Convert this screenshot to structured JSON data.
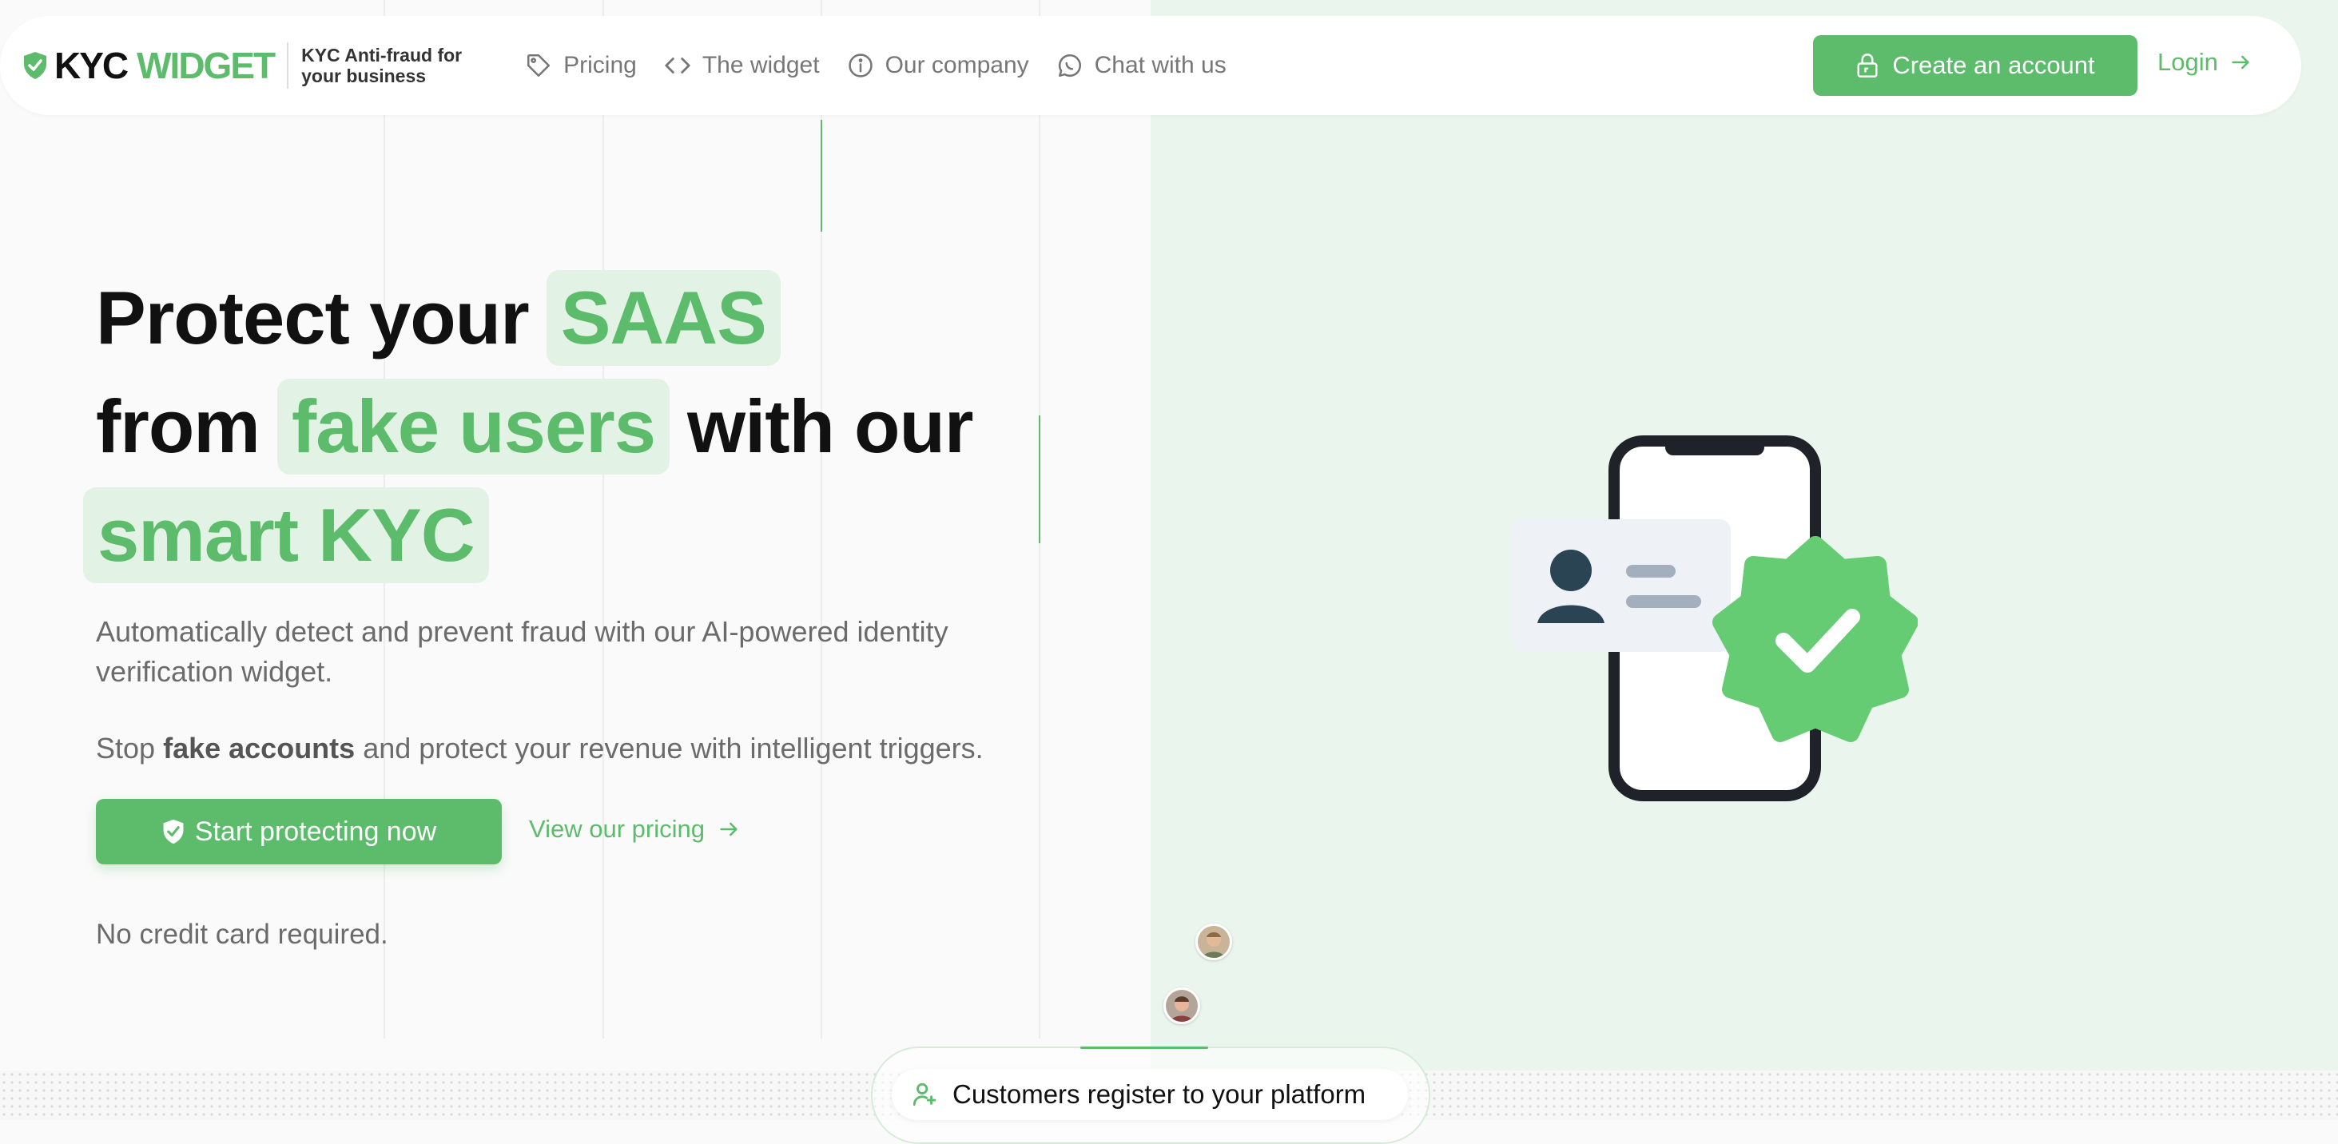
{
  "brand": {
    "kyc": "KYC",
    "widget": "WIDGET",
    "tagline_line1": "KYC Anti-fraud for",
    "tagline_line2": "your business"
  },
  "nav": {
    "items": [
      {
        "label": "Pricing",
        "icon": "tag-icon"
      },
      {
        "label": "The widget",
        "icon": "code-icon"
      },
      {
        "label": "Our company",
        "icon": "info-icon"
      },
      {
        "label": "Chat with us",
        "icon": "chat-icon"
      }
    ],
    "create_account": "Create an account",
    "login": "Login"
  },
  "hero": {
    "line1_text": "Protect your",
    "line1_chip": "SAAS",
    "line2_text": "from",
    "line2_chip": "fake users",
    "line2_tail": "with our",
    "line3_chip": "smart KYC",
    "subtitle": "Automatically detect and prevent fraud with our AI-powered identity verification widget.",
    "sub2_pre": "Stop",
    "sub2_bold": "fake accounts",
    "sub2_post": "and protect your revenue with intelligent triggers.",
    "cta_primary": "Start protecting now",
    "cta_secondary": "View our pricing",
    "no_cc": "No credit card required."
  },
  "flow": {
    "step_label": "Customers register to your platform"
  },
  "colors": {
    "accent": "#5dbb6c",
    "accent_light": "#e2f3e5",
    "right_panel": "#eaf6ed"
  }
}
